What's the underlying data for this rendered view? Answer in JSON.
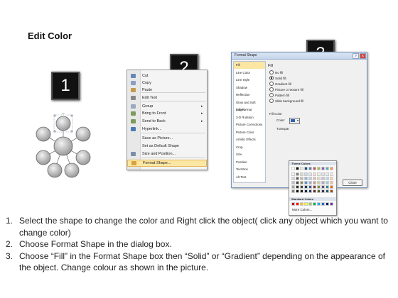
{
  "title": "Edit Color",
  "badges": {
    "one": "1",
    "two": "2",
    "three": "3"
  },
  "context_menu": {
    "items": [
      {
        "label": "Cut",
        "icon": "scissors-icon",
        "color": "#6a86b7"
      },
      {
        "label": "Copy",
        "icon": "copy-icon",
        "color": "#8a9fc2"
      },
      {
        "label": "Paste",
        "icon": "paste-icon",
        "color": "#c79a4a"
      },
      {
        "label": "Edit Text",
        "icon": "edit-text-icon",
        "color": "#888888"
      },
      {
        "label": "Group",
        "icon": "group-icon",
        "color": "#9aa8bd",
        "arrow": "▸"
      },
      {
        "label": "Bring to Front",
        "icon": "bring-front-icon",
        "color": "#7c9a5e",
        "arrow": "▸"
      },
      {
        "label": "Send to Back",
        "icon": "send-back-icon",
        "color": "#7c9a5e",
        "arrow": "▸"
      },
      {
        "label": "Hyperlink...",
        "icon": "globe-link-icon",
        "color": "#4a7bb8"
      },
      {
        "label": "Save as Picture...",
        "icon": "",
        "color": ""
      },
      {
        "label": "Set as Default Shape",
        "icon": "",
        "color": ""
      },
      {
        "label": "Size and Position...",
        "icon": "size-position-icon",
        "color": "#7d8fa8"
      },
      {
        "label": "Format Shape...",
        "icon": "format-shape-icon",
        "color": "#d9a33a"
      }
    ]
  },
  "dialog": {
    "title": "Format Shape",
    "help": "?",
    "close": "X",
    "left_items": [
      "Fill",
      "Line Color",
      "Line Style",
      "Shadow",
      "Reflection",
      "Glow and Soft Edges",
      "3-D Format",
      "3-D Rotation",
      "Picture Corrections",
      "Picture Color",
      "Artistic Effects",
      "Crop",
      "Size",
      "Position",
      "Text Box",
      "Alt Text"
    ],
    "fill_heading": "Fill",
    "radios": [
      "No fill",
      "Solid fill",
      "Gradient fill",
      "Picture or texture fill",
      "Pattern fill",
      "Slide background fill"
    ],
    "fill_color": "Fill Color",
    "color_label": "Color:",
    "transparency_label": "Transpar",
    "theme_colors": "Theme Colors",
    "standard_colors": "Standard Colors",
    "more_colors": "More Colors...",
    "close_button": "Close"
  },
  "steps": [
    {
      "num": "1.",
      "text": "Select the shape to change the color and Right click the object( click any object which you want to change color)"
    },
    {
      "num": "2.",
      "text": "Choose Format Shape in the dialog box."
    },
    {
      "num": "3.",
      "text": "Choose “Fill” in the Format Shape box then “Solid” or “Gradient” depending on the appearance of the object. Change colour as shown in the picture."
    }
  ]
}
